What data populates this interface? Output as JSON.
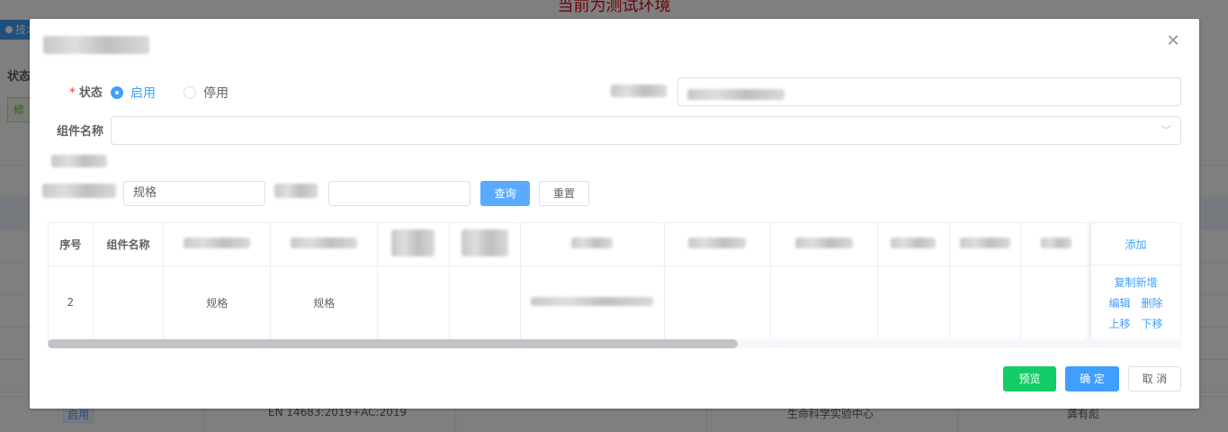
{
  "background": {
    "banner": "当前为测试环境",
    "tab_label": "技术",
    "status_label": "状态",
    "button_label": "修",
    "last_row": {
      "status": "启用",
      "standard": "EN 14683:2019+AC:2019",
      "center": "生命科学实验中心",
      "owner": "龚有彪"
    }
  },
  "dialog": {
    "status_label": "状态",
    "radio_enabled": "启用",
    "radio_disabled": "停用",
    "component_name_label": "组件名称",
    "component_name_value": "",
    "search_value": "规格",
    "search_value2": "",
    "query_button": "查询",
    "reset_button": "重置",
    "table": {
      "headers": [
        "序号",
        "组件名称"
      ],
      "add_link": "添加",
      "row": {
        "index": "2",
        "component_name": "",
        "col3": "规格",
        "col4": "规格"
      },
      "ops": {
        "copy_add": "复制新增",
        "edit": "编辑",
        "delete": "删除",
        "move_up": "上移",
        "move_down": "下移"
      }
    },
    "footer": {
      "preview": "预览",
      "confirm": "确 定",
      "cancel": "取 消"
    }
  },
  "colors": {
    "primary": "#409eff",
    "success": "#13ce66",
    "danger": "#f56c6c",
    "banner_red": "#e60012"
  }
}
